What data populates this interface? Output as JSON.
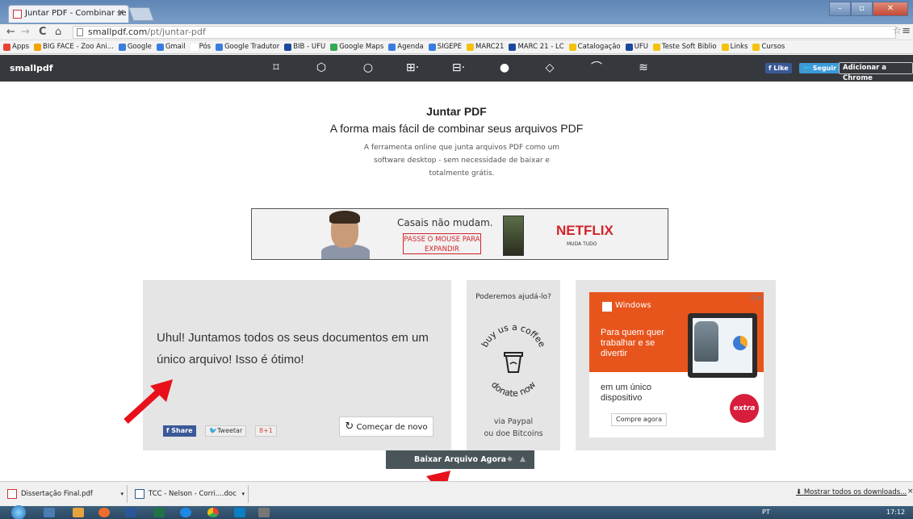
{
  "browser": {
    "tab_title": "Juntar PDF - Combinar se",
    "tab_close": "×",
    "url_host": "smallpdf.com",
    "url_path": "/pt/juntar-pdf",
    "back": "←",
    "forward": "→",
    "reload": "C",
    "home": "⌂",
    "star": "☆",
    "menu": "≡",
    "window_minimize": "–",
    "window_restore": "▫",
    "window_close": "✕"
  },
  "bookmarks": [
    {
      "label": "Apps",
      "color": "#e94235"
    },
    {
      "label": "BIG FACE - Zoo Ani...",
      "color": "#f4a300"
    },
    {
      "label": "Google",
      "color": "#3b7ddd"
    },
    {
      "label": "Gmail",
      "color": "#3b7ddd"
    },
    {
      "label": "Pós",
      "color": "#ffffff"
    },
    {
      "label": "Google Tradutor",
      "color": "#3b7ddd"
    },
    {
      "label": "BIB - UFU",
      "color": "#1a4aa0"
    },
    {
      "label": "Google Maps",
      "color": "#34a853"
    },
    {
      "label": "Agenda",
      "color": "#3b7ddd"
    },
    {
      "label": "SIGEPE",
      "color": "#3b7ddd"
    },
    {
      "label": "MARC21",
      "color": "#f4c20d"
    },
    {
      "label": "MARC 21 - LC",
      "color": "#1a4aa0"
    },
    {
      "label": "Catalogação",
      "color": "#f4c20d"
    },
    {
      "label": "UFU",
      "color": "#1a4aa0"
    },
    {
      "label": "Teste Soft Biblio",
      "color": "#f4c20d"
    },
    {
      "label": "Links",
      "color": "#f4c20d"
    },
    {
      "label": "Cursos",
      "color": "#f4c20d"
    }
  ],
  "smallpdf_nav": {
    "logo": "smallpdf",
    "tools": [
      {
        "icon": "compress-icon",
        "glyph": "⌑"
      },
      {
        "icon": "convert-icon",
        "glyph": "⬡"
      },
      {
        "icon": "pdf-to-icon",
        "glyph": "○"
      },
      {
        "icon": "merge-icon",
        "glyph": "⊞·"
      },
      {
        "icon": "split-icon",
        "glyph": "⊟·"
      },
      {
        "icon": "unlock-icon",
        "glyph": "●"
      },
      {
        "icon": "protect-icon",
        "glyph": "◇"
      },
      {
        "icon": "esign-icon",
        "glyph": "⌒"
      },
      {
        "icon": "new-tool-icon",
        "glyph": "≋"
      }
    ],
    "fb_like": "Like",
    "tw_follow": "Seguir",
    "chrome_button": "Adicionar a Chrome"
  },
  "hero": {
    "title": "Juntar PDF",
    "subtitle": "A forma mais fácil de combinar seus arquivos PDF",
    "description": "A ferramenta online que junta arquivos PDF como um software desktop - sem necessidade de baixar e totalmente grátis."
  },
  "ad_banner": {
    "headline": "Casais não mudam.",
    "cta": "PASSE O MOUSE PARA EXPANDIR",
    "brand": "NETFLIX",
    "tagline": "MUDA TUDO"
  },
  "result_panel": {
    "message": "Uhul! Juntamos todos os seus documentos em um único arquivo! Isso é ótimo!",
    "share": "Share",
    "tweet": "Tweetar",
    "gplus": "8+1",
    "restart": "Começar de novo"
  },
  "help_panel": {
    "title": "Poderemos ajudá-lo?",
    "coffee_top": "buy us a coffee",
    "coffee_bottom": "donate now",
    "paypal_line1": "via Paypal",
    "paypal_line2": "ou doe Bitcoins"
  },
  "windows_ad": {
    "brand": "Windows",
    "headline": "Para quem quer trabalhar e se divertir",
    "subline": "em um único dispositivo",
    "cta": "Compre agora",
    "store": "extra",
    "ad_choices": "ⓘ✕"
  },
  "download_button": {
    "label": "Baixar Arquivo Agora"
  },
  "downloads_shelf": {
    "items": [
      {
        "name": "Dissertação Final.pdf"
      },
      {
        "name": "TCC - Nelson - Corri....doc"
      }
    ],
    "show_all": "Mostrar todos os downloads...",
    "close": "×"
  },
  "taskbar": {
    "tray": "PT",
    "clock": "17:12"
  }
}
